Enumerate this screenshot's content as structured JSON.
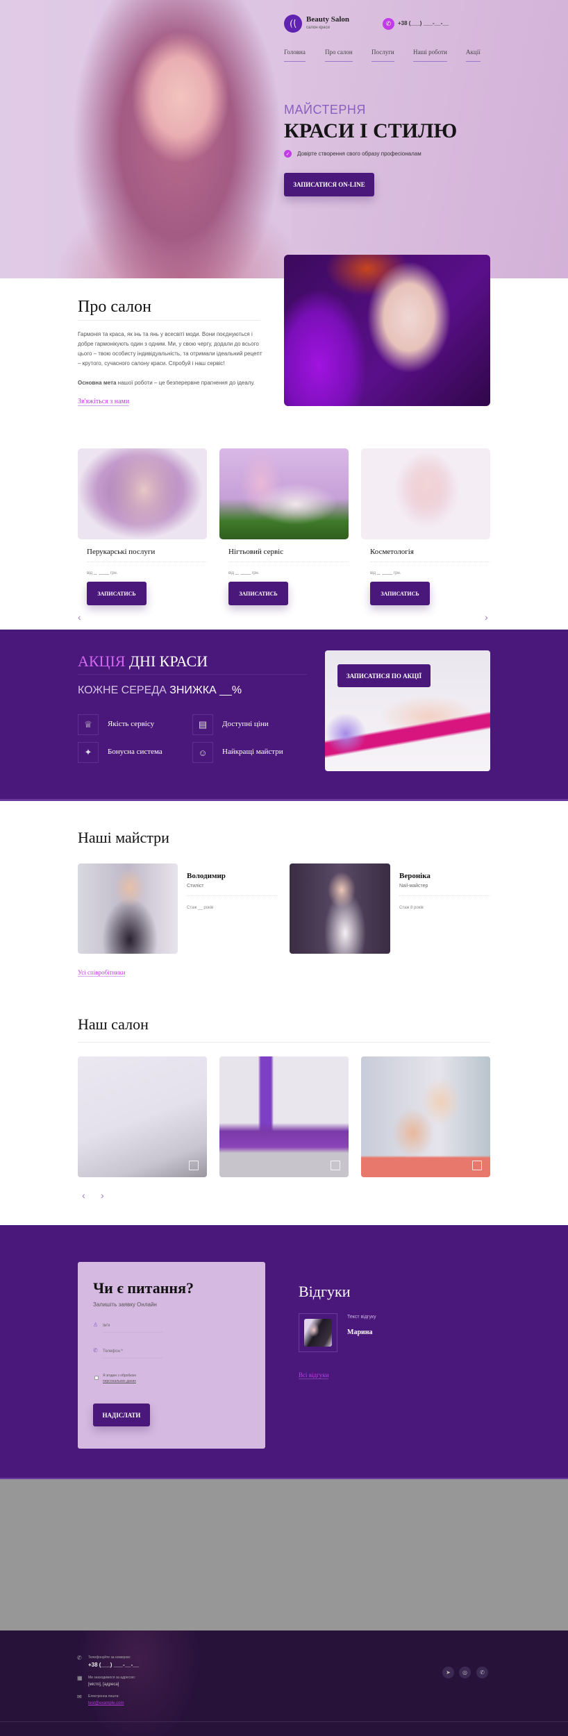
{
  "header": {
    "brand": "Beauty Salon",
    "tagline": "салон краси",
    "phone": "+38 (___) ___-__-__",
    "nav": [
      "Головна",
      "Про салон",
      "Послуги",
      "Наші роботи",
      "Акції"
    ]
  },
  "hero": {
    "kicker": "МАЙСТЕРНЯ",
    "title": "КРАСИ І СТИЛЮ",
    "check_text": "Довірте створення свого образу професіоналам",
    "cta": "ЗАПИСАТИСЯ ON-LINE"
  },
  "about": {
    "title": "Про салон",
    "paragraph": "Гармонія та краса, як інь та янь у всесвіті моди. Вони поєднуються і добре гармонікують один з одним. Ми, у свою чергу, додали до всього цього – твою особисту індивідуальність, та отримали ідеальний рецепт – крутого, сучасного салону краси. Спробуй і наш сервіс!",
    "goal_bold": "Основна мета",
    "goal_rest": " нашої роботи – це безперервне прагнення до ідеалу.",
    "link": "Зв'яжіться з нами"
  },
  "services": {
    "items": [
      {
        "title": "Перукарські послуги",
        "price_prefix": "від",
        "price": "_ ___",
        "currency": "грн.",
        "button": "ЗАПИСАТИСЬ"
      },
      {
        "title": "Нігтьовий сервіс",
        "price_prefix": "від",
        "price": "_ ___",
        "currency": "грн.",
        "button": "ЗАПИСАТИСЬ"
      },
      {
        "title": "Косметологія",
        "price_prefix": "від",
        "price": "_ ___",
        "currency": "грн.",
        "button": "ЗАПИСАТИСЬ"
      }
    ]
  },
  "promo": {
    "title_accent": "АКЦІЯ",
    "title_rest": " ДНІ КРАСИ",
    "sub_light": "КОЖНЕ СЕРЕДА ",
    "sub_bold": "ЗНИЖКА __%",
    "cta": "ЗАПИСАТИСЯ ПО АКЦІЇ",
    "features": [
      "Якість сервісу",
      "Доступні ціни",
      "Бонусна система",
      "Найкращі майстри"
    ]
  },
  "masters": {
    "title": "Наші майстри",
    "items": [
      {
        "name": "Володимир",
        "role": "Стиліст",
        "experience": "Стаж __ років"
      },
      {
        "name": "Вероніка",
        "role": "Nail-майстер",
        "experience": "Стаж 8 років"
      }
    ],
    "link": "Усі співробітники"
  },
  "gallery": {
    "title": "Наш салон"
  },
  "contact": {
    "title": "Чи є питання?",
    "subtitle": "Залишіть заявку Онлайн",
    "name_placeholder": "Ім'я",
    "phone_placeholder": "Телефон *",
    "consent_1": "Я згоден з обробкою",
    "consent_2": "персональних даних",
    "submit": "НАДІСЛАТИ"
  },
  "reviews": {
    "title": "Відгуки",
    "text": "Текст відгуку",
    "author": "Марина",
    "link": "Всі відгуки"
  },
  "footer": {
    "phone_label": "Телефонуйте за номером:",
    "phone": "+38 (___) ___-__-__",
    "address_label": "Ми знаходимося за адресою:",
    "address": "[місто], [адреса]",
    "email_label": "Електронна пошта:",
    "email": "test@example.com"
  },
  "colors": {
    "primary": "#4a177a",
    "accent": "#c23be6",
    "hero_bg": "#dcc2e0",
    "footer": "#27123a",
    "gray": "#979797"
  }
}
